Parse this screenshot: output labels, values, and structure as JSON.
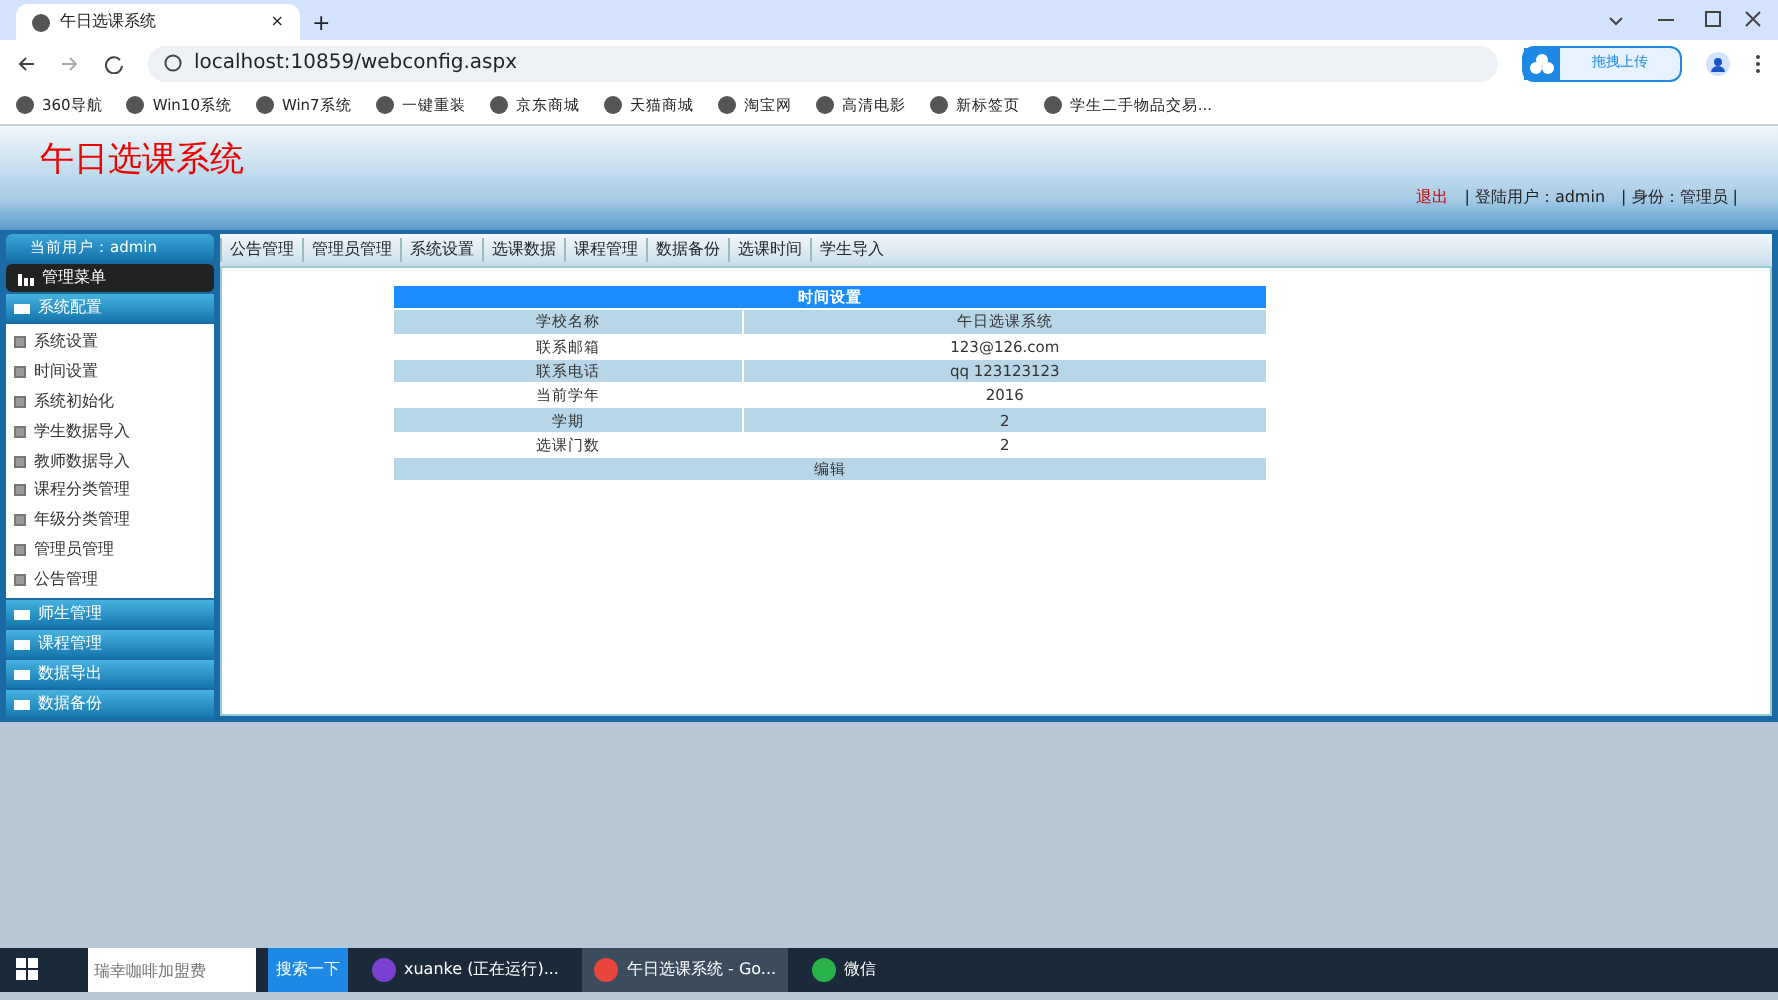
{
  "browser": {
    "tab_title": "午日选课系统",
    "close": "×",
    "new_tab": "+",
    "url": "localhost:10859/webconfig.aspx",
    "upload_button": "拖拽上传",
    "bookmarks": [
      "360导航",
      "Win10系统",
      "Win7系统",
      "一键重装",
      "京东商城",
      "天猫商城",
      "淘宝网",
      "高清电影",
      "新标签页",
      "学生二手物品交易..."
    ]
  },
  "header": {
    "logo": "午日选课系统",
    "links": [
      {
        "text": "退出",
        "kind": "logout"
      },
      {
        "text": "| 登陆用户：admin",
        "kind": "info"
      },
      {
        "text": "| 身份：管理员 |",
        "kind": "info"
      }
    ]
  },
  "top_nav": [
    "公告管理",
    "管理员管理",
    "系统设置",
    "选课数据",
    "课程管理",
    "数据备份",
    "选课时间",
    "学生导入"
  ],
  "sidebar": {
    "user": "当前用户：admin",
    "menu_title": "管理菜单",
    "groups": [
      {
        "title": "系统配置",
        "items": [
          "系统设置",
          "时间设置",
          "系统初始化",
          "学生数据导入",
          "教师数据导入",
          "课程分类管理",
          "年级分类管理",
          "管理员管理",
          "公告管理"
        ]
      },
      {
        "title": "师生管理"
      },
      {
        "title": "课程管理"
      },
      {
        "title": "数据导出"
      },
      {
        "title": "数据备份"
      }
    ]
  },
  "table": {
    "title": "时间设置",
    "rows": [
      [
        "学校名称",
        "午日选课系统"
      ],
      [
        "联系邮箱",
        "123@126.com"
      ],
      [
        "联系电话",
        "qq 123123123"
      ],
      [
        "当前学年",
        "2016"
      ],
      [
        "学期",
        "2"
      ],
      [
        "选课门数",
        "2"
      ]
    ],
    "footer": "编辑"
  },
  "taskbar": {
    "search_placeholder": "瑞幸咖啡加盟费",
    "search_button": "搜索一下",
    "apps": [
      {
        "label": "xuanke (正在运行)...",
        "selected": false
      },
      {
        "label": "午日选课系统 - Go...",
        "selected": true
      },
      {
        "label": "微信",
        "selected": false
      }
    ]
  }
}
